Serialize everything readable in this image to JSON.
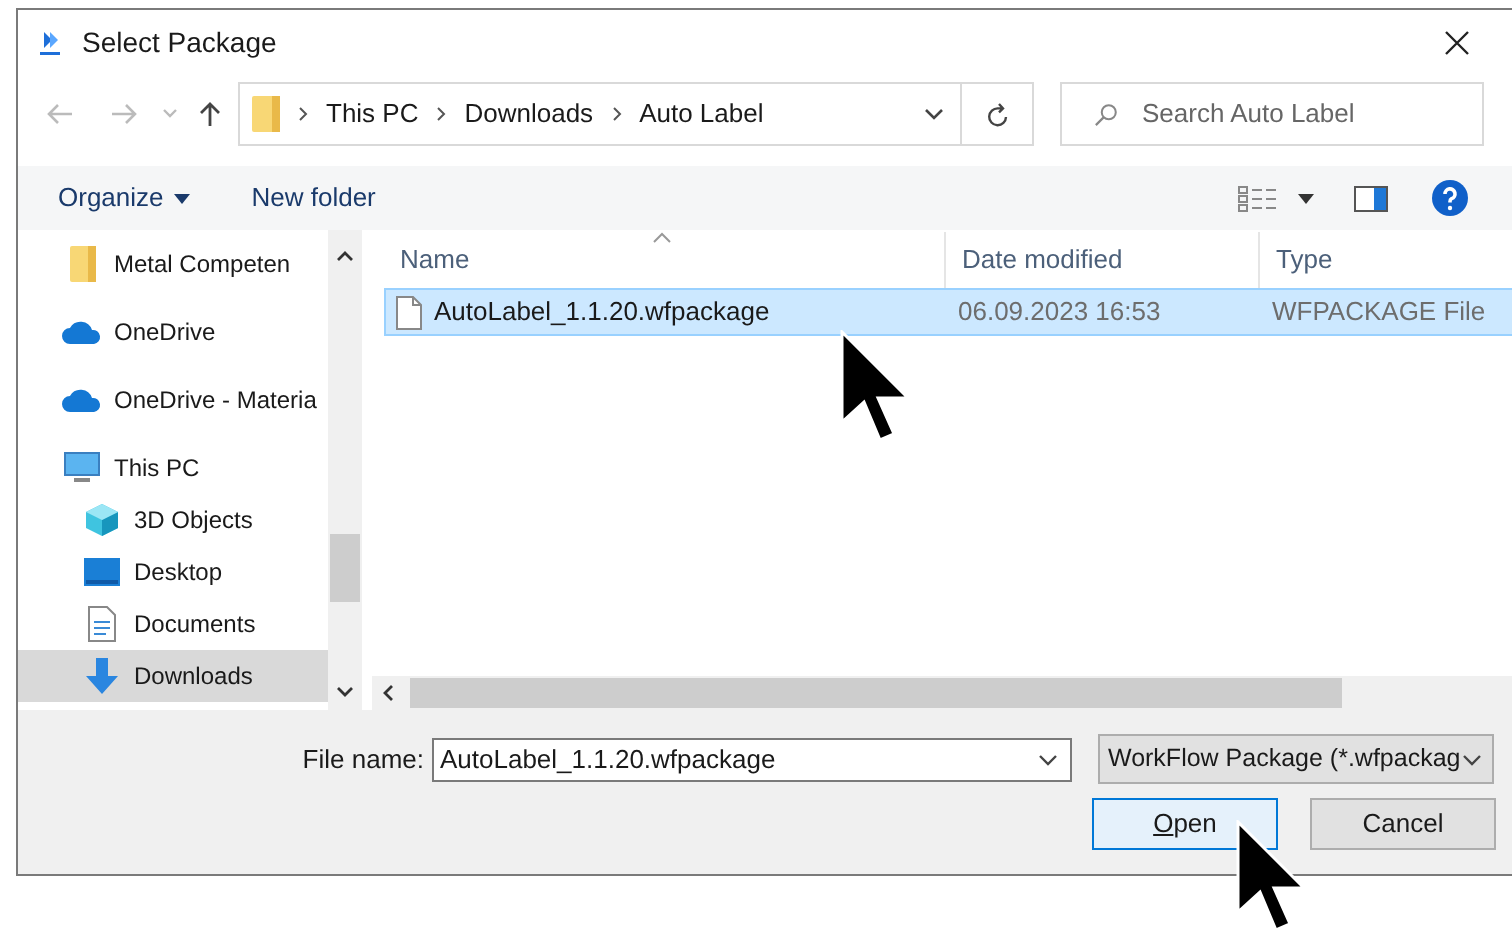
{
  "window": {
    "title": "Select Package"
  },
  "address": {
    "path": [
      "This PC",
      "Downloads",
      "Auto Label"
    ]
  },
  "search": {
    "placeholder": "Search Auto Label"
  },
  "toolbar": {
    "buttons": [
      "Organize",
      "New folder"
    ]
  },
  "sidebar": {
    "items": [
      {
        "label": "Metal Competen",
        "kind": "folder",
        "selected": false
      },
      {
        "label": "OneDrive",
        "kind": "cloud",
        "selected": false
      },
      {
        "label": "OneDrive - Materia",
        "kind": "cloud",
        "selected": false
      },
      {
        "label": "This PC",
        "kind": "computer",
        "selected": false,
        "children": [
          {
            "label": "3D Objects",
            "kind": "cube",
            "selected": false
          },
          {
            "label": "Desktop",
            "kind": "desktop",
            "selected": false
          },
          {
            "label": "Documents",
            "kind": "document",
            "selected": false
          },
          {
            "label": "Downloads",
            "kind": "download",
            "selected": true
          }
        ]
      }
    ]
  },
  "table": {
    "columns": [
      "Name",
      "Date modified",
      "Type"
    ],
    "rows": [
      {
        "cells": [
          "AutoLabel_1.1.20.wfpackage",
          "06.09.2023 16:53",
          "WFPACKAGE File"
        ],
        "selected": true
      }
    ]
  },
  "file_name": {
    "label": "File name:",
    "value": "AutoLabel_1.1.20.wfpackage"
  },
  "file_type": {
    "value": "WorkFlow Package (*.wfpackag"
  },
  "buttons": [
    {
      "label": "Open",
      "default": true
    },
    {
      "label": "Cancel",
      "default": false
    }
  ]
}
